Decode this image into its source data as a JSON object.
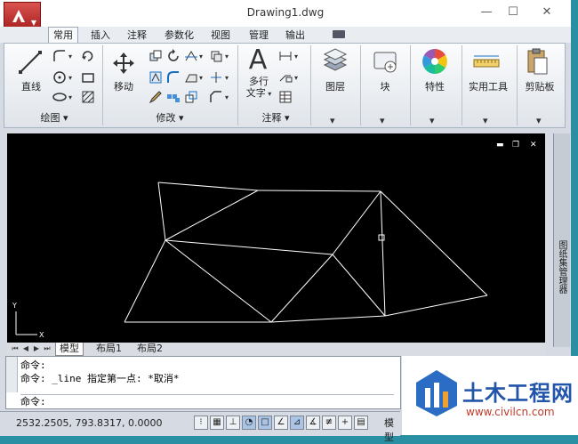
{
  "window": {
    "title": "Drawing1.dwg",
    "controls": {
      "minimize": "—",
      "maximize": "☐",
      "close": "✕"
    }
  },
  "tabs": [
    "常用",
    "插入",
    "注释",
    "参数化",
    "视图",
    "管理",
    "输出"
  ],
  "ribbon": {
    "draw": {
      "line_label": "直线",
      "panel_label": "绘图 ▾"
    },
    "modify": {
      "move_label": "移动",
      "panel_label": "修改 ▾"
    },
    "annotation": {
      "mtext_label": "多行文字",
      "mtext_label_line1": "多行",
      "mtext_label_line2": "文字",
      "mtext_big_letter": "A",
      "panel_label": "注释 ▾"
    },
    "layers": {
      "label": "图层",
      "dropdown": "▾"
    },
    "block": {
      "label": "块",
      "dropdown": "▾"
    },
    "properties": {
      "label": "特性",
      "dropdown": "▾"
    },
    "utilities": {
      "label": "实用工具",
      "dropdown": "▾"
    },
    "clipboard": {
      "label": "剪贴板",
      "dropdown": "▾"
    }
  },
  "drawing": {
    "ucs": {
      "y_label": "Y",
      "x_label": "X"
    },
    "side_palette_label": "图纸集管理器"
  },
  "layout_tabs": [
    "模型",
    "布局1",
    "布局2"
  ],
  "command": {
    "history": [
      "命令:",
      "命令: _line 指定第一点: *取消*"
    ],
    "prompt": "命令:"
  },
  "status": {
    "coordinates": "2532.2505, 793.8317, 0.0000",
    "model_label": "模型"
  },
  "watermark": {
    "brand": "土木工程网",
    "url": "www.civilcn.com"
  },
  "colors": {
    "drawing_background": "#000000",
    "line_color": "#ffffff",
    "app_button": "#c0302b",
    "watermark_blue": "#2255aa"
  }
}
